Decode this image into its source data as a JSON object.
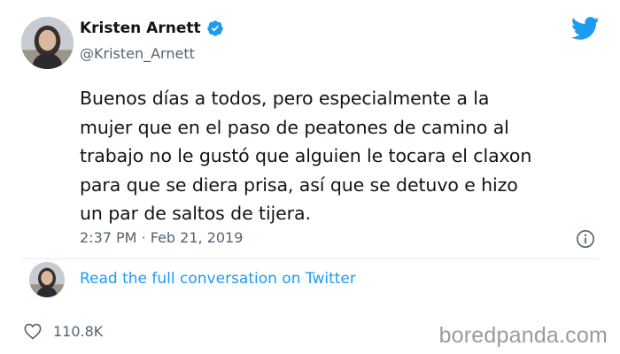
{
  "author": {
    "display_name": "Kristen Arnett",
    "handle": "@Kristen_Arnett",
    "verified": true
  },
  "tweet": {
    "text_lines": [
      "Buenos días a todos, pero especialmente a la",
      "mujer que en el paso de peatones de camino al",
      "trabajo no le gustó que alguien le tocara el claxon",
      "para que se diera prisa, así que se detuvo e hizo",
      "un par de saltos de tijera."
    ],
    "time": "2:37 PM",
    "separator": "·",
    "date": "Feb 21, 2019"
  },
  "conversation": {
    "link_label": "Read the full conversation on Twitter"
  },
  "engagement": {
    "likes": "110.8K"
  },
  "watermark": "boredpanda.com",
  "icons": {
    "verified": "verified-badge-icon",
    "brand": "twitter-bird-icon",
    "info": "info-icon",
    "like": "heart-icon"
  },
  "colors": {
    "text": "#0f1419",
    "secondary": "#536471",
    "link": "#1d9bf0",
    "brand": "#1d9bf0"
  }
}
